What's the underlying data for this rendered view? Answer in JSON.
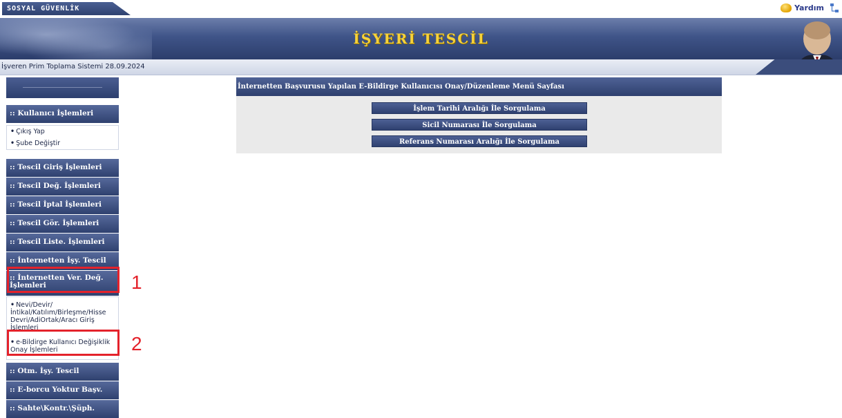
{
  "app": {
    "brand": "SOSYAL GÜVENLİK KURUMU",
    "help_label": "Yardım",
    "banner_title": "İŞYERİ TESCİL",
    "subheader": "İşveren Prim Toplama Sistemi 28.09.2024"
  },
  "sidebar": {
    "user_section": {
      "title": ":: Kullanıcı İşlemleri",
      "items": [
        {
          "label": "Çıkış Yap"
        },
        {
          "label": "Şube Değiştir"
        }
      ]
    },
    "menus": [
      ":: Tescil Giriş İşlemleri",
      ":: Tescil Değ. İşlemleri",
      ":: Tescil İptal İşlemleri",
      ":: Tescil Gör. İşlemleri",
      ":: Tescil Liste. İşlemleri",
      ":: İnternetten İşy. Tescil"
    ],
    "active_menu": ":: İnternetten Ver. Değ. İşlemleri",
    "active_items": [
      {
        "label": "Nevi/Devir/ İntikal/Katılım/Birleşme/Hisse Devri/AdiOrtak/Aracı Giriş İşlemleri"
      },
      {
        "label": "e-Bildirge Kullanıcı Değişiklik Onay İşlemleri"
      }
    ],
    "bottom_menus": [
      ":: Otm. İşy. Tescil",
      ":: E-borcu Yoktur Başv.",
      ":: Sahte\\Kontr.\\Şüph."
    ]
  },
  "annotations": {
    "marker_1": "1",
    "marker_2": "2",
    "color": "#e4222b"
  },
  "main": {
    "panel_title": "İnternetten Başvurusu Yapılan E-Bildirge Kullanıcısı Onay/Düzenleme Menü Sayfası",
    "buttons": [
      "İşlem Tarihi Aralığı İle Sorgulama",
      "Sicil Numarası İle Sorgulama",
      "Referans Numarası Aralığı İle Sorgulama"
    ]
  },
  "colors": {
    "navy": "#2f416f",
    "title_gold": "#f6d23b"
  }
}
